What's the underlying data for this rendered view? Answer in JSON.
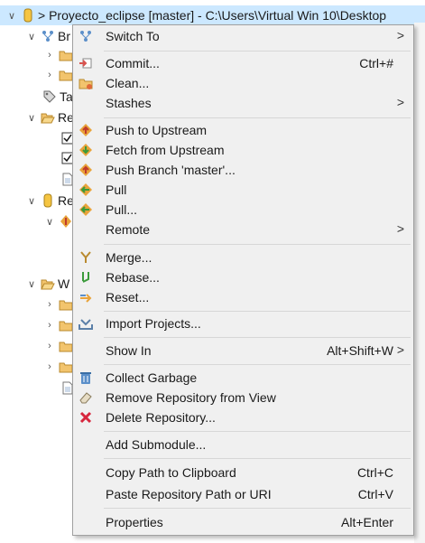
{
  "tree": {
    "root_title": "> Proyecto_eclipse [master] - C:\\Users\\Virtual Win 10\\Desktop",
    "rows_visible": [
      "Br",
      "Ta",
      "Re",
      "Re",
      "W"
    ]
  },
  "menu": {
    "switch_to": {
      "label": "Switch To",
      "submenu_arrow": ">"
    },
    "commit": {
      "label": "Commit...",
      "shortcut": "Ctrl+#"
    },
    "clean": {
      "label": "Clean..."
    },
    "stashes": {
      "label": "Stashes",
      "submenu_arrow": ">"
    },
    "push_upstream": {
      "label": "Push to Upstream"
    },
    "fetch_upstream": {
      "label": "Fetch from Upstream"
    },
    "push_branch": {
      "label": "Push Branch 'master'..."
    },
    "pull": {
      "label": "Pull"
    },
    "pull_dialog": {
      "label": "Pull..."
    },
    "remote": {
      "label": "Remote",
      "submenu_arrow": ">"
    },
    "merge": {
      "label": "Merge..."
    },
    "rebase": {
      "label": "Rebase..."
    },
    "reset": {
      "label": "Reset..."
    },
    "import_projects": {
      "label": "Import Projects..."
    },
    "show_in": {
      "label": "Show In",
      "shortcut": "Alt+Shift+W",
      "submenu_arrow": ">"
    },
    "collect_garbage": {
      "label": "Collect Garbage"
    },
    "remove_repo": {
      "label": "Remove Repository from View"
    },
    "delete_repo": {
      "label": "Delete Repository..."
    },
    "add_submodule": {
      "label": "Add Submodule..."
    },
    "copy_path": {
      "label": "Copy Path to Clipboard",
      "shortcut": "Ctrl+C"
    },
    "paste_path": {
      "label": "Paste Repository Path or URI",
      "shortcut": "Ctrl+V"
    },
    "properties": {
      "label": "Properties",
      "shortcut": "Alt+Enter"
    }
  },
  "colors": {
    "selection": "#cce8ff",
    "menu_bg": "#f0f0f0",
    "push_icon": "#e8a33a",
    "delete_icon": "#d7263d"
  }
}
